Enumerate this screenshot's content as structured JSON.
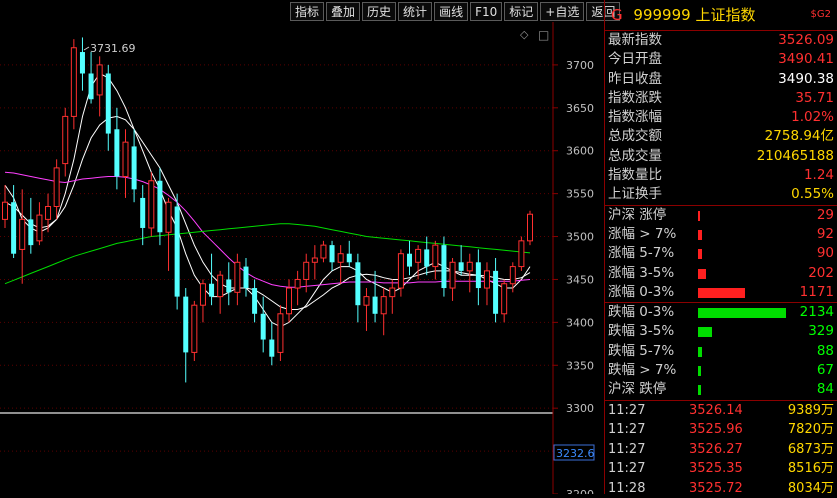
{
  "toolbar": {
    "buttons": [
      "指标",
      "叠加",
      "历史",
      "统计",
      "画线",
      "F10",
      "标记",
      "+自选",
      "返回"
    ]
  },
  "chart_data": {
    "type": "candlestick",
    "ylim": [
      3200,
      3750
    ],
    "yticks": [
      3700,
      3650,
      3600,
      3550,
      3500,
      3450,
      3400,
      3350,
      3300,
      3250,
      3200
    ],
    "max_annotation": "3731.69",
    "current_price_label": "3232.6",
    "candles": [
      [
        3520,
        3560,
        3510,
        3540
      ],
      [
        3540,
        3560,
        3475,
        3480
      ],
      [
        3485,
        3555,
        3445,
        3520
      ],
      [
        3520,
        3545,
        3480,
        3490
      ],
      [
        3495,
        3540,
        3490,
        3525
      ],
      [
        3520,
        3550,
        3505,
        3535
      ],
      [
        3535,
        3590,
        3520,
        3580
      ],
      [
        3585,
        3650,
        3570,
        3640
      ],
      [
        3640,
        3730,
        3625,
        3720
      ],
      [
        3715,
        3732,
        3670,
        3690
      ],
      [
        3690,
        3715,
        3655,
        3660
      ],
      [
        3665,
        3710,
        3640,
        3700
      ],
      [
        3690,
        3700,
        3600,
        3620
      ],
      [
        3625,
        3650,
        3555,
        3570
      ],
      [
        3570,
        3625,
        3545,
        3610
      ],
      [
        3605,
        3625,
        3540,
        3555
      ],
      [
        3545,
        3560,
        3490,
        3510
      ],
      [
        3510,
        3575,
        3500,
        3565
      ],
      [
        3565,
        3580,
        3490,
        3505
      ],
      [
        3505,
        3545,
        3460,
        3540
      ],
      [
        3535,
        3550,
        3415,
        3430
      ],
      [
        3430,
        3440,
        3330,
        3365
      ],
      [
        3365,
        3425,
        3355,
        3420
      ],
      [
        3420,
        3450,
        3400,
        3445
      ],
      [
        3445,
        3480,
        3420,
        3430
      ],
      [
        3430,
        3460,
        3410,
        3455
      ],
      [
        3450,
        3470,
        3420,
        3435
      ],
      [
        3435,
        3480,
        3420,
        3470
      ],
      [
        3465,
        3475,
        3430,
        3440
      ],
      [
        3440,
        3450,
        3400,
        3410
      ],
      [
        3410,
        3430,
        3365,
        3380
      ],
      [
        3380,
        3400,
        3350,
        3360
      ],
      [
        3365,
        3420,
        3355,
        3410
      ],
      [
        3410,
        3450,
        3400,
        3440
      ],
      [
        3440,
        3460,
        3420,
        3450
      ],
      [
        3450,
        3480,
        3435,
        3470
      ],
      [
        3470,
        3490,
        3450,
        3475
      ],
      [
        3475,
        3495,
        3470,
        3490
      ],
      [
        3490,
        3495,
        3460,
        3470
      ],
      [
        3470,
        3490,
        3445,
        3480
      ],
      [
        3480,
        3495,
        3465,
        3470
      ],
      [
        3470,
        3480,
        3400,
        3420
      ],
      [
        3420,
        3440,
        3390,
        3430
      ],
      [
        3430,
        3460,
        3400,
        3410
      ],
      [
        3410,
        3440,
        3385,
        3430
      ],
      [
        3430,
        3450,
        3410,
        3440
      ],
      [
        3440,
        3485,
        3430,
        3480
      ],
      [
        3480,
        3495,
        3455,
        3465
      ],
      [
        3470,
        3490,
        3450,
        3485
      ],
      [
        3485,
        3500,
        3455,
        3465
      ],
      [
        3465,
        3495,
        3450,
        3490
      ],
      [
        3490,
        3500,
        3430,
        3440
      ],
      [
        3440,
        3475,
        3425,
        3470
      ],
      [
        3470,
        3490,
        3455,
        3460
      ],
      [
        3460,
        3480,
        3435,
        3470
      ],
      [
        3470,
        3485,
        3420,
        3440
      ],
      [
        3440,
        3470,
        3420,
        3460
      ],
      [
        3460,
        3475,
        3400,
        3410
      ],
      [
        3410,
        3450,
        3400,
        3445
      ],
      [
        3445,
        3470,
        3435,
        3465
      ],
      [
        3465,
        3500,
        3460,
        3495
      ],
      [
        3495,
        3530,
        3490,
        3526
      ]
    ],
    "ma_series": [
      {
        "color": "#ffffff",
        "values": [
          3560,
          3545,
          3520,
          3510,
          3505,
          3510,
          3520,
          3550,
          3590,
          3640,
          3675,
          3690,
          3685,
          3670,
          3650,
          3625,
          3600,
          3575,
          3555,
          3530,
          3510,
          3480,
          3455,
          3440,
          3430,
          3430,
          3435,
          3440,
          3440,
          3430,
          3415,
          3400,
          3395,
          3400,
          3410,
          3420,
          3435,
          3450,
          3460,
          3465,
          3465,
          3460,
          3450,
          3445,
          3440,
          3435,
          3440,
          3450,
          3460,
          3465,
          3470,
          3465,
          3460,
          3455,
          3455,
          3455,
          3450,
          3445,
          3440,
          3440,
          3450,
          3465
        ]
      },
      {
        "color": "#ffffff",
        "values": [
          3540,
          3535,
          3525,
          3515,
          3510,
          3512,
          3520,
          3535,
          3560,
          3590,
          3615,
          3630,
          3638,
          3640,
          3636,
          3625,
          3610,
          3595,
          3580,
          3560,
          3540,
          3515,
          3490,
          3470,
          3455,
          3445,
          3440,
          3440,
          3440,
          3438,
          3432,
          3425,
          3418,
          3415,
          3415,
          3418,
          3425,
          3432,
          3440,
          3445,
          3452,
          3455,
          3456,
          3455,
          3452,
          3450,
          3450,
          3452,
          3455,
          3458,
          3460,
          3460,
          3460,
          3458,
          3456,
          3455,
          3454,
          3452,
          3450,
          3450,
          3452,
          3458
        ]
      },
      {
        "color": "#ff40ff",
        "values": [
          3575,
          3574,
          3572,
          3570,
          3568,
          3566,
          3564,
          3563,
          3565,
          3567,
          3568,
          3569,
          3570,
          3570,
          3569,
          3567,
          3564,
          3560,
          3555,
          3548,
          3540,
          3530,
          3518,
          3505,
          3495,
          3485,
          3475,
          3466,
          3458,
          3452,
          3448,
          3444,
          3442,
          3441,
          3441,
          3442,
          3443,
          3444,
          3445,
          3446,
          3447,
          3447,
          3447,
          3447,
          3446,
          3446,
          3446,
          3446,
          3447,
          3447,
          3447,
          3448,
          3448,
          3448,
          3448,
          3448,
          3448,
          3448,
          3448,
          3448,
          3449,
          3450
        ]
      },
      {
        "color": "#00dd00",
        "values": [
          3445,
          3449,
          3453,
          3457,
          3461,
          3465,
          3469,
          3473,
          3477,
          3480,
          3483,
          3486,
          3489,
          3492,
          3494,
          3496,
          3498,
          3500,
          3501,
          3502,
          3503,
          3504,
          3505,
          3506,
          3507,
          3508,
          3509,
          3510,
          3511,
          3512,
          3513,
          3514,
          3515,
          3515,
          3514,
          3513,
          3512,
          3510,
          3508,
          3506,
          3504,
          3502,
          3500,
          3499,
          3498,
          3497,
          3496,
          3495,
          3494,
          3493,
          3492,
          3491,
          3490,
          3489,
          3488,
          3487,
          3486,
          3485,
          3484,
          3483,
          3482,
          3481
        ]
      }
    ]
  },
  "panel": {
    "title_code": "999999",
    "title_name": "上证指数",
    "title_g": "G",
    "title_sg": "$G2",
    "stats": [
      {
        "label": "最新指数",
        "value": "3526.09",
        "color": "#ff3030"
      },
      {
        "label": "今日开盘",
        "value": "3490.41",
        "color": "#ff3030"
      },
      {
        "label": "昨日收盘",
        "value": "3490.38",
        "color": "#ffffff"
      },
      {
        "label": "指数涨跌",
        "value": "35.71",
        "color": "#ff3030"
      },
      {
        "label": "指数涨幅",
        "value": "1.02%",
        "color": "#ff3030"
      },
      {
        "label": "总成交额",
        "value": "2758.94亿",
        "color": "#ffd700"
      },
      {
        "label": "总成交量",
        "value": "210465188",
        "color": "#ffd700"
      },
      {
        "label": "指数量比",
        "value": "1.24",
        "color": "#ff3030"
      },
      {
        "label": "上证换手",
        "value": "0.55%",
        "color": "#ffd700"
      }
    ],
    "up_dist": [
      {
        "label": "沪深 涨停",
        "value": "29",
        "count": 29
      },
      {
        "label": "涨幅 > 7%",
        "value": "92",
        "count": 92
      },
      {
        "label": "涨幅 5-7%",
        "value": "90",
        "count": 90
      },
      {
        "label": "涨幅 3-5%",
        "value": "202",
        "count": 202
      },
      {
        "label": "涨幅 0-3%",
        "value": "1171",
        "count": 1171
      }
    ],
    "down_dist": [
      {
        "label": "跌幅 0-3%",
        "value": "2134",
        "count": 2134
      },
      {
        "label": "跌幅 3-5%",
        "value": "329",
        "count": 329
      },
      {
        "label": "跌幅 5-7%",
        "value": "88",
        "count": 88
      },
      {
        "label": "跌幅 > 7%",
        "value": "67",
        "count": 67
      },
      {
        "label": "沪深 跌停",
        "value": "84",
        "count": 84
      }
    ],
    "trades": [
      {
        "time": "11:27",
        "price": "3526.14",
        "volume": "9389万"
      },
      {
        "time": "11:27",
        "price": "3525.96",
        "volume": "7820万"
      },
      {
        "time": "11:27",
        "price": "3526.27",
        "volume": "6873万"
      },
      {
        "time": "11:27",
        "price": "3525.35",
        "volume": "8516万"
      },
      {
        "time": "11:28",
        "price": "3525.72",
        "volume": "8034万"
      }
    ]
  }
}
